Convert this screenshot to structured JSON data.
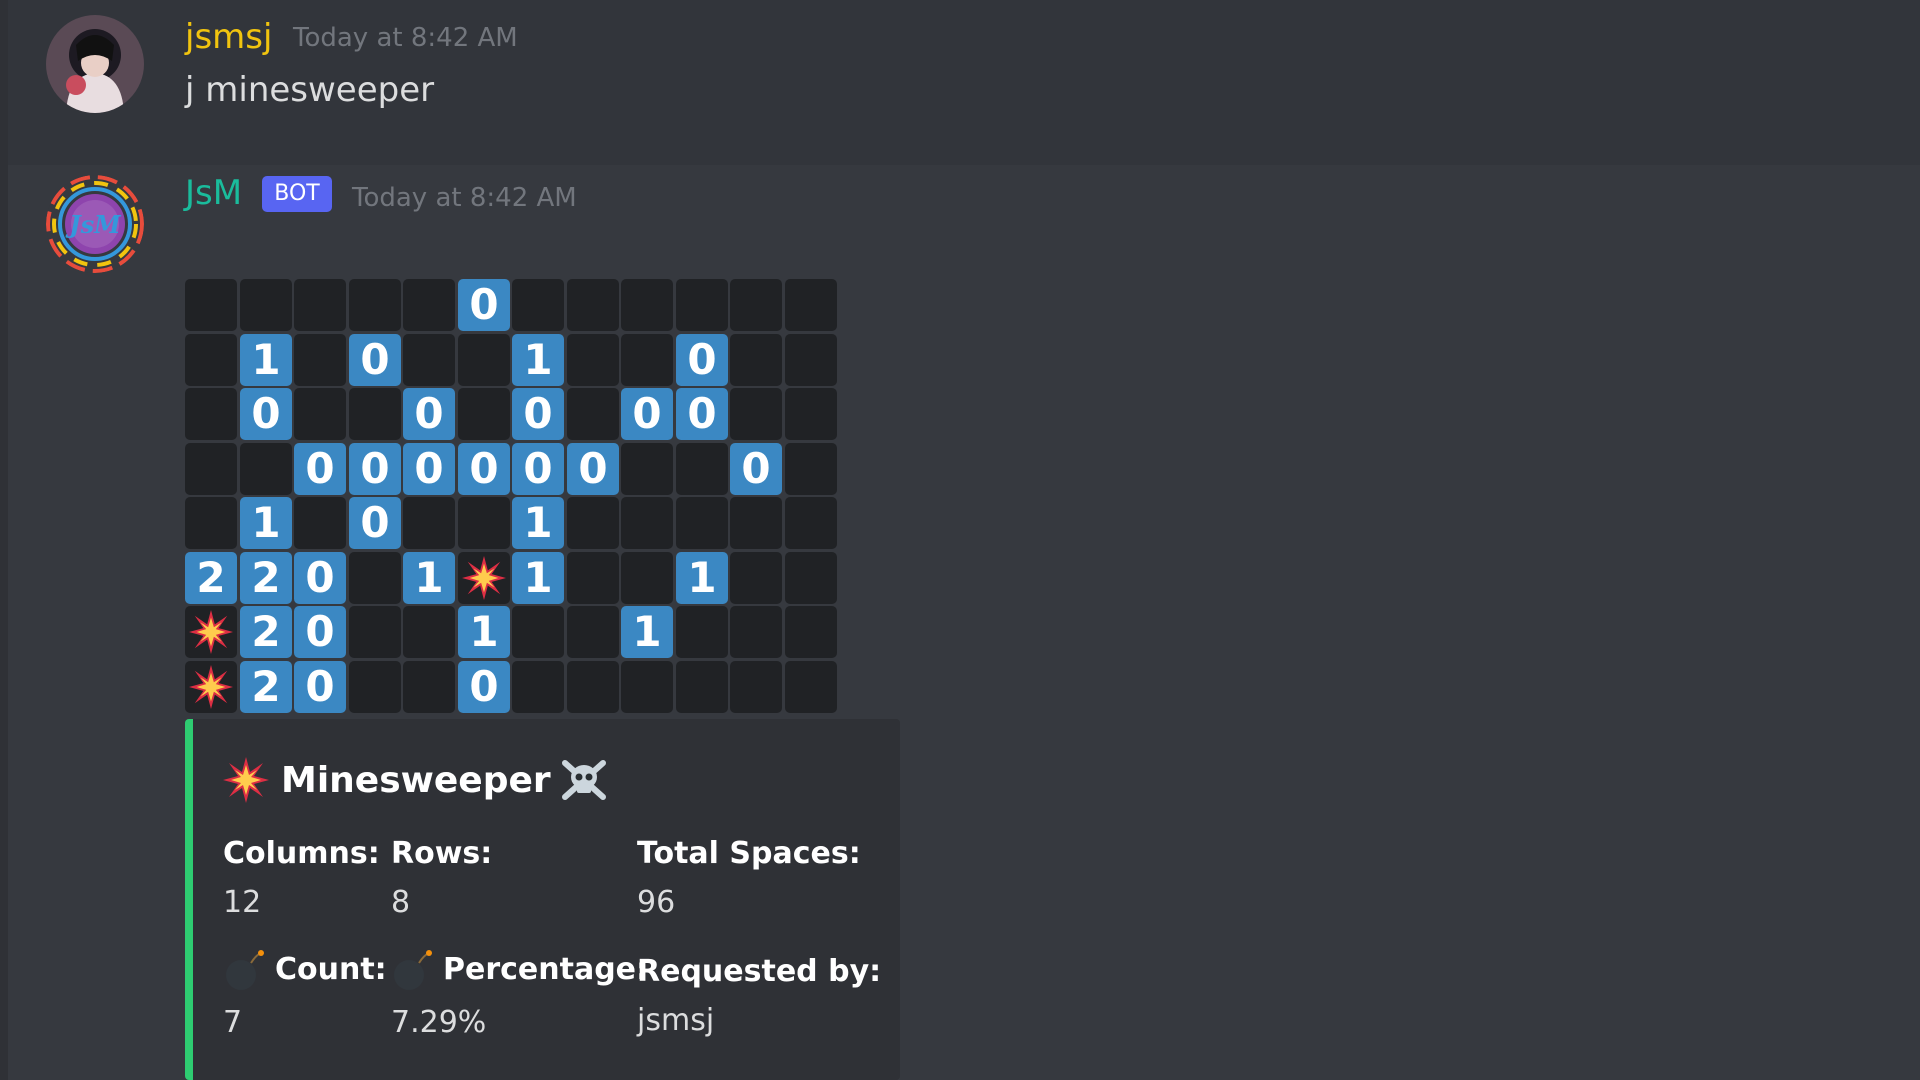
{
  "messages": [
    {
      "author": "jsmsj",
      "author_color": "#f1c40f",
      "timestamp": "Today at 8:42 AM",
      "content": "j minesweeper"
    },
    {
      "author": "JsM",
      "author_color": "#1abc9c",
      "badge": "BOT",
      "timestamp": "Today at 8:42 AM",
      "avatar_text": "JsM"
    }
  ],
  "board": {
    "columns": 12,
    "rows": 8,
    "cells": [
      [
        "",
        "",
        "",
        "",
        "",
        "0",
        "",
        "",
        "",
        "",
        "",
        ""
      ],
      [
        "",
        "1",
        "",
        "0",
        "",
        "",
        "1",
        "",
        "",
        "0",
        "",
        ""
      ],
      [
        "",
        "0",
        "",
        "",
        "0",
        "",
        "0",
        "",
        "0",
        "0",
        "",
        ""
      ],
      [
        "",
        "",
        "0",
        "0",
        "0",
        "0",
        "0",
        "0",
        "",
        "",
        "0",
        ""
      ],
      [
        "",
        "1",
        "",
        "0",
        "",
        "",
        "1",
        "",
        "",
        "",
        "",
        ""
      ],
      [
        "2",
        "2",
        "0",
        "",
        "1",
        "*",
        "1",
        "",
        "",
        "1",
        "",
        ""
      ],
      [
        "*",
        "2",
        "0",
        "",
        "",
        "1",
        "",
        "",
        "1",
        "",
        "",
        ""
      ],
      [
        "*",
        "2",
        "0",
        "",
        "",
        "0",
        "",
        "",
        "",
        "",
        "",
        ""
      ]
    ],
    "legend": {
      "hidden": "",
      "bomb": "*"
    }
  },
  "embed": {
    "accent_color": "#2ecc71",
    "title": "Minesweeper",
    "title_icons": [
      "collision-icon",
      "skull-crossbones-icon"
    ],
    "fields": [
      {
        "name": "Columns:",
        "value": "12"
      },
      {
        "name": "Rows:",
        "value": "8"
      },
      {
        "name": "Total Spaces:",
        "value": "96"
      },
      {
        "name": "Count:",
        "value": "7",
        "icon": "bomb-icon"
      },
      {
        "name": "Percentage:",
        "value": "7.29%",
        "icon": "bomb-icon"
      },
      {
        "name": "Requested by:",
        "value": "jsmsj"
      }
    ]
  }
}
